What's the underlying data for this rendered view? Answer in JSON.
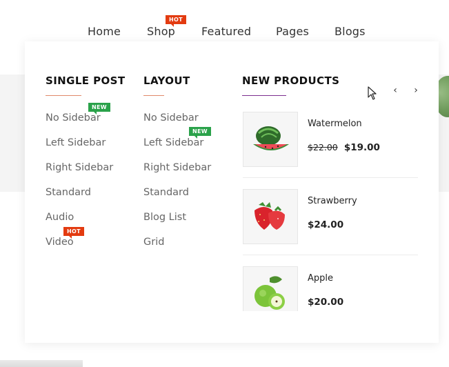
{
  "nav": {
    "items": [
      {
        "label": "Home"
      },
      {
        "label": "Shop",
        "badge": "HOT"
      },
      {
        "label": "Featured"
      },
      {
        "label": "Pages"
      },
      {
        "label": "Blogs"
      }
    ]
  },
  "mega_menu": {
    "single_post": {
      "title": "SINGLE POST",
      "accent": "#e0896a",
      "links": [
        {
          "label": "No Sidebar",
          "badge": "NEW"
        },
        {
          "label": "Left Sidebar"
        },
        {
          "label": "Right Sidebar"
        },
        {
          "label": "Standard"
        },
        {
          "label": "Audio"
        },
        {
          "label": "Video",
          "badge": "HOT"
        }
      ]
    },
    "layout": {
      "title": "LAYOUT",
      "accent": "#e0896a",
      "links": [
        {
          "label": "No Sidebar"
        },
        {
          "label": "Left Sidebar",
          "badge": "NEW"
        },
        {
          "label": "Right Sidebar"
        },
        {
          "label": "Standard"
        },
        {
          "label": "Blog List"
        },
        {
          "label": "Grid"
        }
      ]
    },
    "new_products": {
      "title": "NEW PRODUCTS",
      "accent": "#7b2d8e",
      "prev_icon": "chevron-left-icon",
      "next_icon": "chevron-right-icon",
      "products": [
        {
          "name": "Watermelon",
          "old_price": "$22.00",
          "price": "$19.00",
          "image": "watermelon"
        },
        {
          "name": "Strawberry",
          "price": "$24.00",
          "image": "strawberry"
        },
        {
          "name": "Apple",
          "price": "$20.00",
          "image": "apple"
        }
      ]
    }
  },
  "colors": {
    "hot_badge": "#e33b10",
    "new_badge": "#2aa24a"
  }
}
